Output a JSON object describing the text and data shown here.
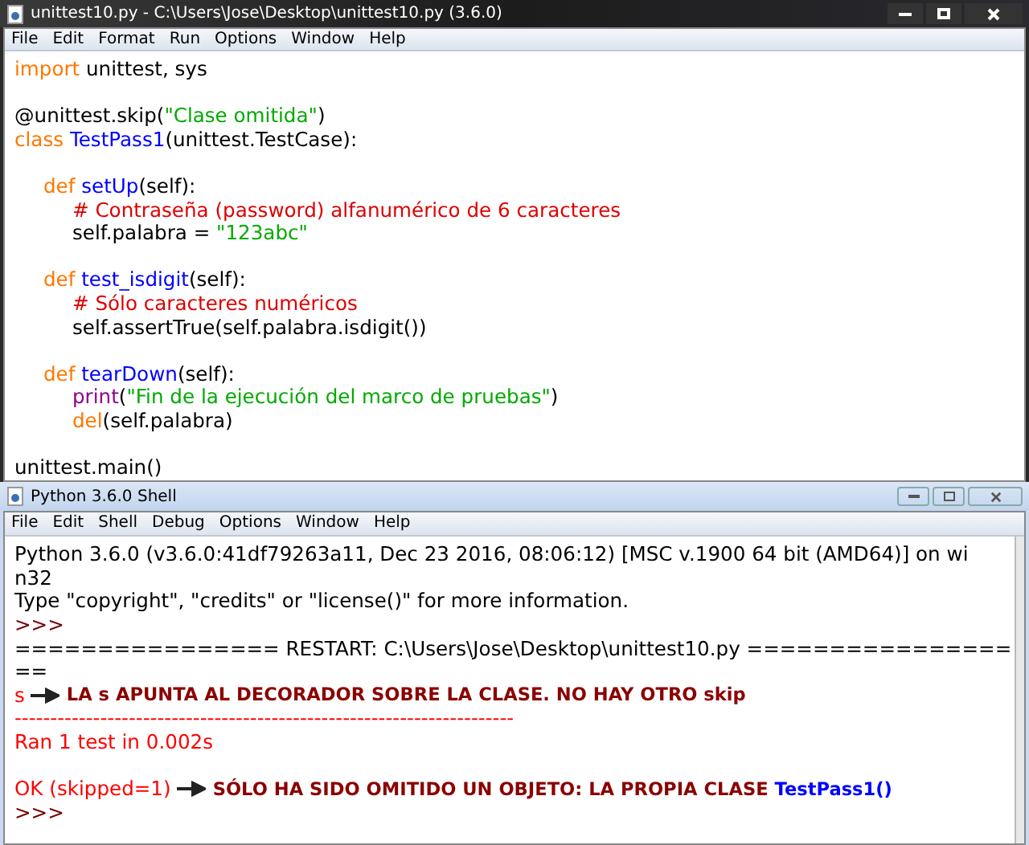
{
  "editor": {
    "title": "unittest10.py - C:\\Users\\Jose\\Desktop\\unittest10.py (3.6.0)",
    "menu": [
      "File",
      "Edit",
      "Format",
      "Run",
      "Options",
      "Window",
      "Help"
    ],
    "lines": [
      {
        "kind": "code",
        "tokens": [
          {
            "t": "import ",
            "kind": "keyword"
          },
          {
            "t": "unittest, sys",
            "kind": "plain"
          }
        ]
      },
      {
        "kind": "blank"
      },
      {
        "kind": "code",
        "tokens": [
          {
            "t": "@unittest.skip(",
            "kind": "plain"
          },
          {
            "t": "\"Clase omitida\"",
            "kind": "string"
          },
          {
            "t": ")",
            "kind": "plain"
          }
        ]
      },
      {
        "kind": "code",
        "tokens": [
          {
            "t": "class ",
            "kind": "keyword"
          },
          {
            "t": "TestPass1",
            "kind": "name"
          },
          {
            "t": "(unittest.TestCase):",
            "kind": "plain"
          }
        ],
        "children": [
          {
            "kind": "blank"
          },
          {
            "kind": "code",
            "tokens": [
              {
                "t": "def ",
                "kind": "keyword"
              },
              {
                "t": "setUp",
                "kind": "name"
              },
              {
                "t": "(self):",
                "kind": "plain"
              }
            ],
            "children": [
              {
                "kind": "code",
                "tokens": [
                  {
                    "t": "# Contraseña (password) alfanumérico de 6 caracteres",
                    "kind": "comment"
                  }
                ]
              },
              {
                "kind": "code",
                "tokens": [
                  {
                    "t": "self.palabra = ",
                    "kind": "plain"
                  },
                  {
                    "t": "\"123abc\"",
                    "kind": "string"
                  }
                ]
              }
            ]
          },
          {
            "kind": "blank"
          },
          {
            "kind": "code",
            "tokens": [
              {
                "t": "def ",
                "kind": "keyword"
              },
              {
                "t": "test_isdigit",
                "kind": "name"
              },
              {
                "t": "(self):",
                "kind": "plain"
              }
            ],
            "children": [
              {
                "kind": "code",
                "tokens": [
                  {
                    "t": "# Sólo caracteres numéricos",
                    "kind": "comment"
                  }
                ]
              },
              {
                "kind": "code",
                "tokens": [
                  {
                    "t": "self.assertTrue(self.palabra.isdigit())",
                    "kind": "plain"
                  }
                ]
              }
            ]
          },
          {
            "kind": "blank"
          },
          {
            "kind": "code",
            "tokens": [
              {
                "t": "def ",
                "kind": "keyword"
              },
              {
                "t": "tearDown",
                "kind": "name"
              },
              {
                "t": "(self):",
                "kind": "plain"
              }
            ],
            "children": [
              {
                "kind": "code",
                "tokens": [
                  {
                    "t": "print",
                    "kind": "builtin"
                  },
                  {
                    "t": "(",
                    "kind": "plain"
                  },
                  {
                    "t": "\"Fin de la ejecución del marco de pruebas\"",
                    "kind": "string"
                  },
                  {
                    "t": ")",
                    "kind": "plain"
                  }
                ]
              },
              {
                "kind": "code",
                "tokens": [
                  {
                    "t": "del",
                    "kind": "keyword"
                  },
                  {
                    "t": "(self.palabra)",
                    "kind": "plain"
                  }
                ]
              }
            ]
          }
        ]
      },
      {
        "kind": "blank"
      },
      {
        "kind": "code",
        "tokens": [
          {
            "t": "unittest.main()",
            "kind": "plain"
          }
        ]
      }
    ]
  },
  "shell": {
    "title": "Python 3.6.0 Shell",
    "menu": [
      "File",
      "Edit",
      "Shell",
      "Debug",
      "Options",
      "Window",
      "Help"
    ],
    "lines": [
      {
        "kind": "code",
        "tokens": [
          {
            "t": "Python 3.6.0 (v3.6.0:41df79263a11, Dec 23 2016, 08:06:12) [MSC v.1900 64 bit (AMD64)] on wi",
            "kind": "plain"
          }
        ]
      },
      {
        "kind": "code",
        "tokens": [
          {
            "t": "n32",
            "kind": "plain"
          }
        ]
      },
      {
        "kind": "code",
        "tokens": [
          {
            "t": "Type \"copyright\", \"credits\" or \"license()\" for more information.",
            "kind": "plain"
          }
        ]
      },
      {
        "kind": "code",
        "tokens": [
          {
            "t": ">>>",
            "kind": "prompt"
          }
        ]
      },
      {
        "kind": "code",
        "tokens": [
          {
            "t": "================ RESTART: C:\\Users\\Jose\\Desktop\\unittest10.py ================",
            "kind": "plain"
          }
        ]
      },
      {
        "kind": "code",
        "tokens": [
          {
            "t": "==",
            "kind": "plain"
          }
        ]
      },
      {
        "kind": "code",
        "tokens": [
          {
            "t": "s",
            "kind": "error"
          },
          {
            "kind": "arrow"
          },
          {
            "t": "LA s APUNTA AL DECORADOR SOBRE LA CLASE. NO HAY OTRO skip",
            "kind": "note"
          }
        ]
      },
      {
        "kind": "code",
        "tokens": [
          {
            "t": "----------------------------------------------------------------------",
            "kind": "error"
          }
        ]
      },
      {
        "kind": "code",
        "tokens": [
          {
            "t": "Ran 1 test in 0.002s",
            "kind": "error"
          }
        ]
      },
      {
        "kind": "blank"
      },
      {
        "kind": "code",
        "tokens": [
          {
            "t": "OK (skipped=1)",
            "kind": "error"
          },
          {
            "kind": "arrow"
          },
          {
            "t": "SÓLO HA SIDO OMITIDO UN OBJETO: LA PROPIA CLASE ",
            "kind": "note"
          },
          {
            "t": "TestPass1()",
            "kind": "notename"
          }
        ]
      },
      {
        "kind": "code",
        "tokens": [
          {
            "t": ">>>",
            "kind": "prompt"
          }
        ]
      }
    ]
  }
}
